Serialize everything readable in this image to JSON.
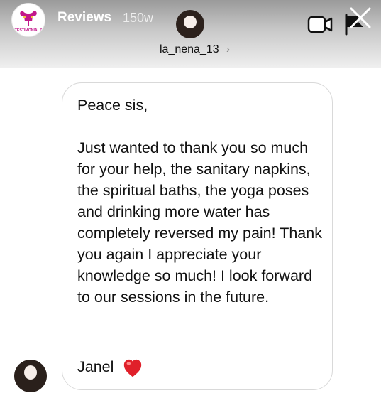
{
  "story": {
    "title": "Reviews",
    "age": "150w",
    "avatar_label": "TESTIMONIALS"
  },
  "sender": {
    "username": "la_nena_13",
    "chevron": "›"
  },
  "message": {
    "greeting": "Peace sis,",
    "body": "Just wanted to thank you so much for your help, the sanitary napkins, the spiritual baths, the yoga poses and drinking more water has completely reversed my pain! Thank you again I appreciate your knowledge so much! I look forward to our sessions in the future.",
    "signature": "Janel"
  },
  "icons": {
    "video": "video-camera-icon",
    "flag": "flag-icon",
    "close": "close-icon",
    "heart": "heart-icon"
  },
  "colors": {
    "heart": "#e0202a",
    "logo_pink": "#c2188b"
  }
}
